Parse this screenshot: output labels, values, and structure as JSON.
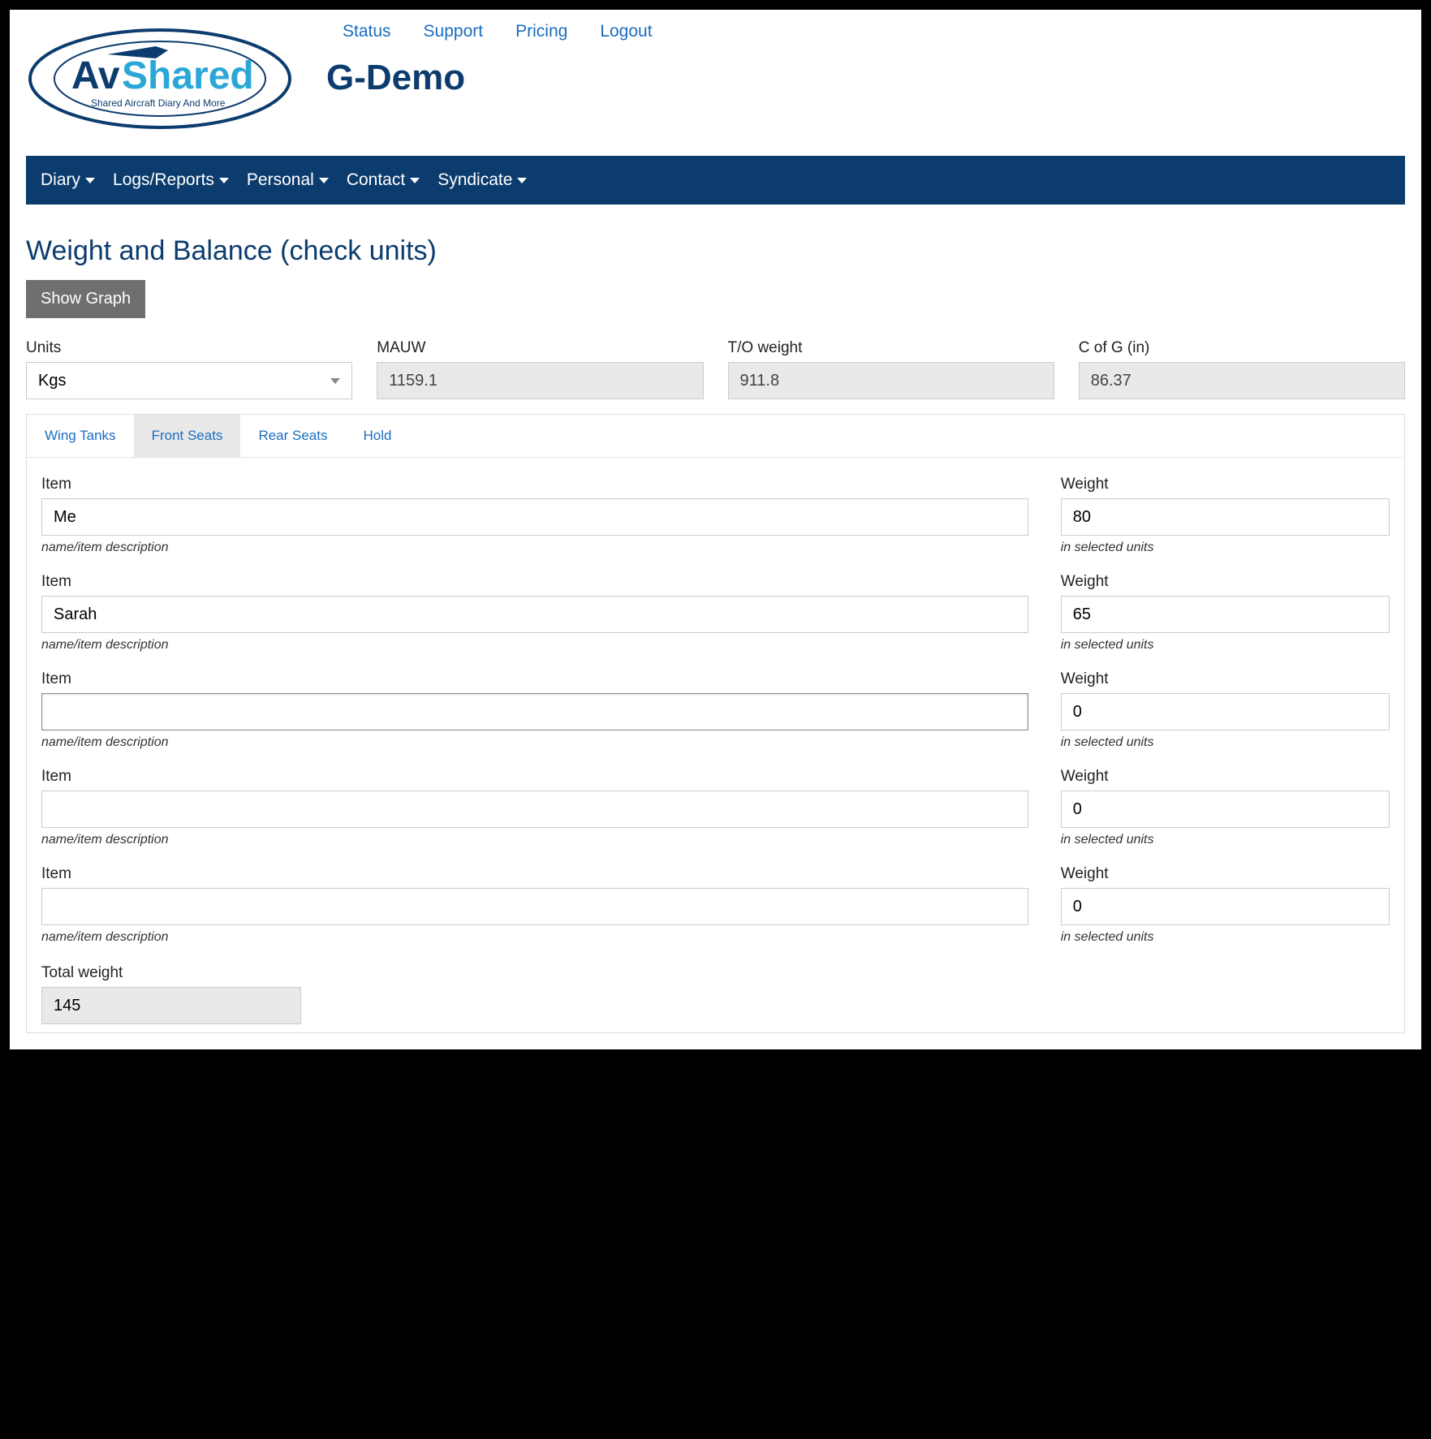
{
  "header": {
    "links": [
      "Status",
      "Support",
      "Pricing",
      "Logout"
    ],
    "aircraft": "G-Demo",
    "logo_main": "AvShared",
    "logo_tag": "Shared Aircraft Diary And More"
  },
  "navbar": [
    "Diary",
    "Logs/Reports",
    "Personal",
    "Contact",
    "Syndicate"
  ],
  "page": {
    "title": "Weight and Balance (check units)",
    "show_graph": "Show Graph"
  },
  "summary": {
    "units_label": "Units",
    "units_value": "Kgs",
    "mauw_label": "MAUW",
    "mauw_value": "1159.1",
    "to_label": "T/O weight",
    "to_value": "911.8",
    "cog_label": "C of G (in)",
    "cog_value": "86.37"
  },
  "tabs": [
    "Wing Tanks",
    "Front Seats",
    "Rear Seats",
    "Hold"
  ],
  "active_tab": 1,
  "columns": {
    "item": "Item",
    "weight": "Weight",
    "item_help": "name/item description",
    "weight_help": "in selected units"
  },
  "rows": [
    {
      "name": "Me",
      "weight": "80"
    },
    {
      "name": "Sarah",
      "weight": "65"
    },
    {
      "name": "",
      "weight": "0"
    },
    {
      "name": "",
      "weight": "0"
    },
    {
      "name": "",
      "weight": "0"
    }
  ],
  "total": {
    "label": "Total weight",
    "value": "145"
  }
}
